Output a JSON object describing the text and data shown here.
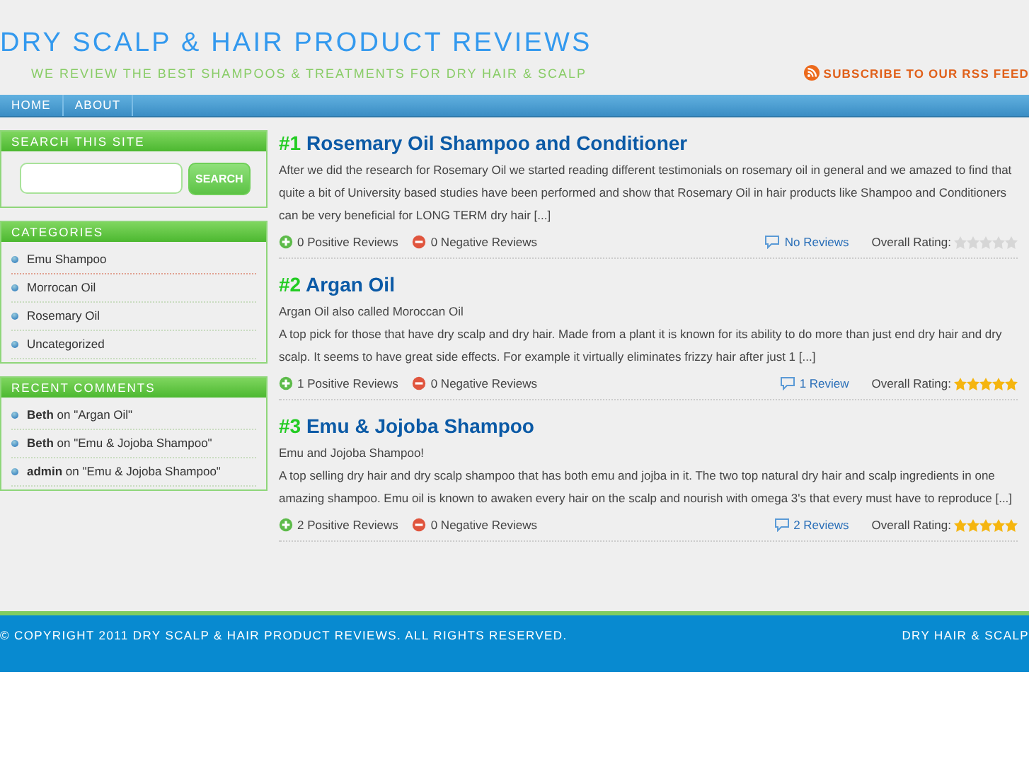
{
  "header": {
    "title": "DRY SCALP & HAIR PRODUCT REVIEWS",
    "tagline": "WE REVIEW THE BEST SHAMPOOS & TREATMENTS FOR DRY HAIR & SCALP",
    "rss": "SUBSCRIBE TO OUR RSS FEED"
  },
  "nav": [
    {
      "label": "HOME"
    },
    {
      "label": "ABOUT"
    }
  ],
  "sidebar": {
    "search": {
      "title": "SEARCH THIS SITE",
      "button": "SEARCH"
    },
    "categories": {
      "title": "CATEGORIES",
      "items": [
        "Emu Shampoo",
        "Morrocan Oil",
        "Rosemary Oil",
        "Uncategorized"
      ]
    },
    "recent_comments": {
      "title": "RECENT COMMENTS",
      "items": [
        {
          "author": "Beth",
          "on": "on",
          "post": "\"Argan Oil\""
        },
        {
          "author": "Beth",
          "on": "on",
          "post": "\"Emu & Jojoba Shampoo\""
        },
        {
          "author": "admin",
          "on": "on",
          "post": "\"Emu & Jojoba Shampoo\""
        }
      ]
    }
  },
  "posts": [
    {
      "rank": "#1",
      "title": "Rosemary Oil Shampoo and Conditioner",
      "paragraphs": [
        "After we did the research for Rosemary Oil we started reading different testimonials on rosemary oil in general and we amazed to find that quite a bit of University based studies have been performed and show that Rosemary Oil in hair products like Shampoo and Conditioners can be very beneficial for LONG TERM dry hair [...]"
      ],
      "positive": "0 Positive Reviews",
      "negative": "0 Negative Reviews",
      "reviews": "No Reviews",
      "rating_label": "Overall Rating:",
      "stars": 0
    },
    {
      "rank": "#2",
      "title": "Argan Oil",
      "paragraphs": [
        "Argan Oil also called Moroccan Oil",
        "A top pick for those that have dry scalp and dry hair. Made from a plant it is known for its ability to do more than just end dry hair and dry scalp. It seems to have great side effects. For example it virtually eliminates frizzy hair after just 1 [...]"
      ],
      "positive": "1 Positive Reviews",
      "negative": "0 Negative Reviews",
      "reviews": "1 Review",
      "rating_label": "Overall Rating:",
      "stars": 5
    },
    {
      "rank": "#3",
      "title": "Emu & Jojoba Shampoo",
      "paragraphs": [
        "Emu and Jojoba Shampoo!",
        "A top selling dry hair and dry scalp shampoo that has both emu and jojba in it. The two top natural dry hair and scalp ingredients in one amazing shampoo. Emu oil is known to awaken every hair on the scalp and nourish with omega 3's that every must have to reproduce [...]"
      ],
      "positive": "2 Positive Reviews",
      "negative": "0 Negative Reviews",
      "reviews": "2 Reviews",
      "rating_label": "Overall Rating:",
      "stars": 5
    }
  ],
  "footer": {
    "copyright": "© COPYRIGHT 2011 DRY SCALP & HAIR PRODUCT REVIEWS. ALL RIGHTS RESERVED.",
    "right": "DRY HAIR & SCALP"
  }
}
